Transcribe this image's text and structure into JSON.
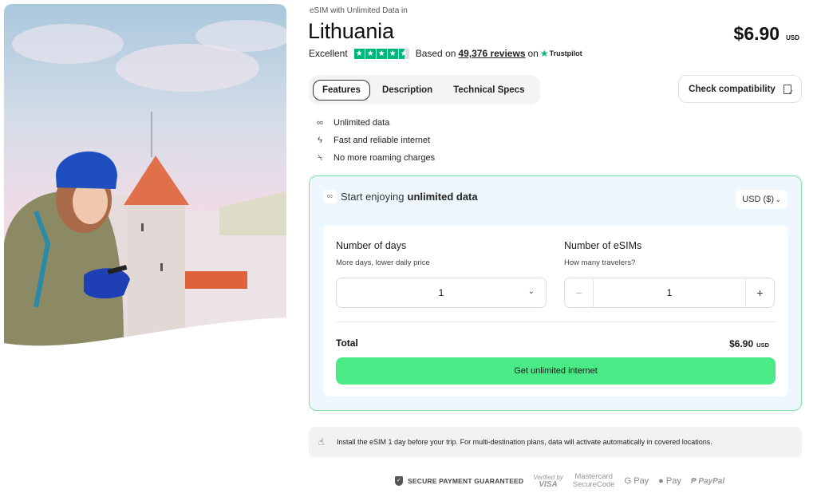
{
  "product": {
    "eyebrow": "eSIM with Unlimited Data in",
    "title": "Lithuania",
    "price": "$6.90",
    "currency": "USD"
  },
  "rating": {
    "label": "Excellent",
    "stars": 4.5,
    "based_on": "Based on",
    "reviews": "49,376 reviews",
    "on": "on",
    "provider": "Trustpilot"
  },
  "tabs": [
    {
      "label": "Features",
      "active": true
    },
    {
      "label": "Description",
      "active": false
    },
    {
      "label": "Technical Specs",
      "active": false
    }
  ],
  "check_compatibility": {
    "label": "Check compatibility",
    "icon": "phone-check-icon"
  },
  "features": [
    {
      "icon": "infinity-icon",
      "glyph": "∞",
      "label": "Unlimited data"
    },
    {
      "icon": "lightning-icon",
      "glyph": "ϟ",
      "label": "Fast and reliable internet"
    },
    {
      "icon": "no-signal-icon",
      "glyph": "⍀",
      "label": "No more roaming charges"
    }
  ],
  "plan": {
    "heading_prefix": "Start enjoying",
    "heading_bold": "unlimited data",
    "currency_select": "USD ($)",
    "days": {
      "label": "Number of days",
      "sublabel": "More days, lower daily price",
      "value": "1"
    },
    "esims": {
      "label": "Number of eSIMs",
      "sublabel": "How many travelers?",
      "value": "1",
      "minus": "−",
      "plus": "+"
    },
    "total_label": "Total",
    "total_price": "$6.90",
    "total_currency": "USD",
    "cta": "Get unlimited internet"
  },
  "notice": "Install the eSIM 1 day before your trip. For multi-destination plans, data will activate automatically in covered locations.",
  "payments": {
    "secure": "SECURE PAYMENT GUARANTEED",
    "visa_top": "Verified by",
    "visa_bottom": "VISA",
    "mc_top": "Mastercard",
    "mc_bottom": "SecureCode",
    "gpay": "G Pay",
    "apay": " Pay",
    "paypal": "PayPal"
  },
  "colors": {
    "accent_green": "#4aea87",
    "trustpilot_green": "#00b67a",
    "plan_bg": "#eef7fe",
    "plan_border": "#7ce0a4"
  }
}
